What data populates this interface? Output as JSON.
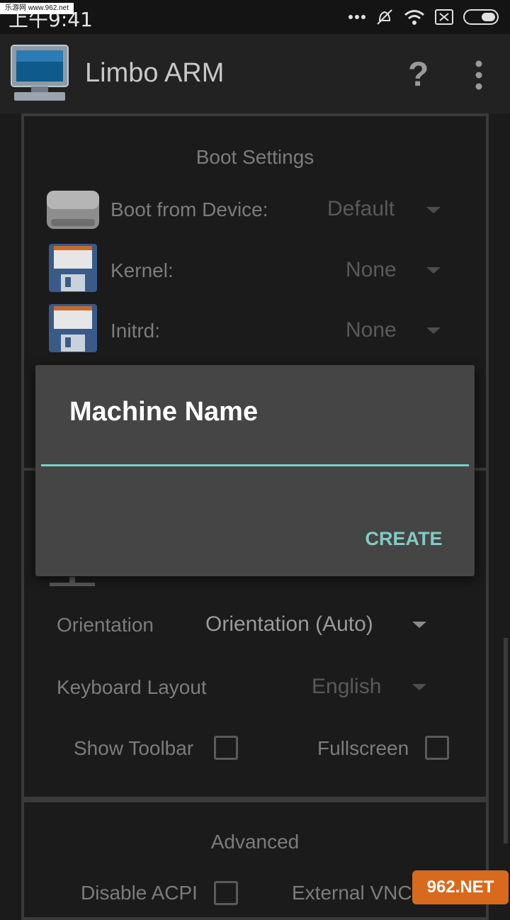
{
  "status_bar": {
    "time": "上午9:41",
    "watermark": "乐游网 www.962.net"
  },
  "app_bar": {
    "title": "Limbo ARM",
    "help_glyph": "?"
  },
  "boot_settings": {
    "title": "Boot Settings",
    "rows": [
      {
        "label": "Boot from Device:",
        "value": "Default"
      },
      {
        "label": "Kernel:",
        "value": "None"
      },
      {
        "label": "Initrd:",
        "value": "None"
      }
    ]
  },
  "display_settings": {
    "orientation_label": "Orientation",
    "orientation_value": "Orientation (Auto)",
    "keyboard_label": "Keyboard Layout",
    "keyboard_value": "English",
    "show_toolbar_label": "Show Toolbar",
    "fullscreen_label": "Fullscreen"
  },
  "advanced": {
    "title": "Advanced",
    "disable_acpi_label": "Disable ACPI",
    "external_vnc_label": "External VNC"
  },
  "dialog": {
    "title": "Machine Name",
    "input_value": "",
    "create_label": "CREATE"
  },
  "watermark_bottom": "962.NET",
  "colors": {
    "accent": "#80cbc4",
    "dialog_bg": "#454545",
    "background": "#1b1b1b"
  }
}
